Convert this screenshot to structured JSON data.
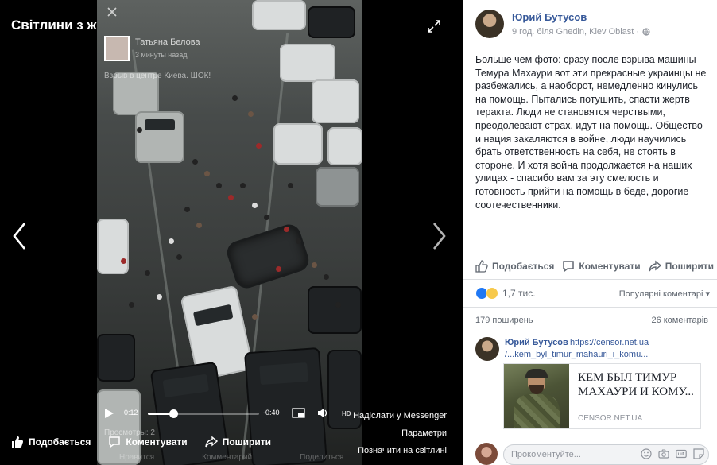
{
  "theater": {
    "album_title": "Світлини з життєпису",
    "poster_name": "Татьяна Белова",
    "poster_time": "3 минуты назад",
    "caption": "Взрыв в центре Киева. ШОК!",
    "video": {
      "current_time": "0:12",
      "remaining_time": "-0:40",
      "hd_label": "HD",
      "progress_fraction": 0.23,
      "views": "Просмотры: 2"
    },
    "menu": {
      "send_messenger": "Надіслати у Messenger",
      "options": "Параметри",
      "tag_photo": "Позначити на світлині"
    },
    "actions": {
      "like": "Подобається",
      "comment": "Коментувати",
      "share": "Поширити"
    },
    "faded_actions": {
      "like": "Нравится",
      "comment": "Комментарий",
      "share": "Поделиться"
    }
  },
  "post": {
    "author": "Юрий Бутусов",
    "meta": "9 год. біля Gnedin, Kiev Oblast ·",
    "text": "Больше чем фото: сразу после взрыва машины Темура Махаури вот эти прекрасные украинцы не разбежались, а наоборот, немедленно кинулись на помощь. Пытались потушить, спасти жертв теракта. Люди не становятся черствыми, преодолевают страх, идут на помощь. Общество и нация закаляются в войне, люди научились брать ответственность на себя, не стоять в стороне. И хотя война продолжается на наших улицах - спасибо вам за эту смелость и готовность прийти на помощь в беде, дорогие соотечественники.",
    "actions": {
      "like": "Подобається",
      "comment": "Коментувати",
      "share": "Поширити"
    },
    "reactions_count": "1,7 тис.",
    "sort_label": "Популярні коментарі ▾",
    "shares": "179 поширень",
    "comments_count": "26 коментарів"
  },
  "comment": {
    "author": "Юрий Бутусов",
    "link_line1": "https://censor.net.ua",
    "link_line2": "/...kem_byl_timur_mahauri_i_komu...",
    "card": {
      "title": "КЕМ БЫЛ ТИМУР МАХАУРИ И КОМУ...",
      "domain": "CENSOR.NET.UA"
    }
  },
  "comment_input": {
    "placeholder": "Прокоментуйте..."
  },
  "colors": {
    "link_blue": "#365899",
    "like_blue": "#2078f4",
    "panel_bg": "#ffffff",
    "theater_bg": "#000000"
  }
}
